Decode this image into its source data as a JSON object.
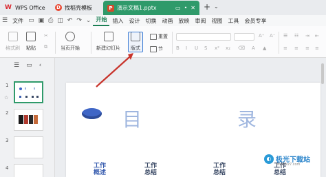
{
  "tabs": {
    "wps": {
      "logo": "W",
      "label": "WPS Office"
    },
    "template": {
      "logo": "D",
      "label": "找稻壳模板"
    },
    "doc": {
      "logo": "P",
      "label": "演示文稿1.pptx"
    },
    "add": "+",
    "more": "⌄"
  },
  "menu": {
    "hamburger": "☰",
    "file": "文件",
    "items": [
      "开始",
      "插入",
      "设计",
      "切换",
      "动画",
      "放映",
      "审阅",
      "视图",
      "工具",
      "会员专享"
    ],
    "active_index": 0
  },
  "ribbon": {
    "format_painter": "格式刷",
    "paste": "粘贴",
    "start_show": "当页开始",
    "new_slide": "新建幻灯片",
    "layout": "版式",
    "section": "节",
    "reset": "重置"
  },
  "sidebar": {
    "slides": [
      {
        "num": "1",
        "star": "☆"
      },
      {
        "num": "2"
      },
      {
        "num": "3"
      },
      {
        "num": "4"
      }
    ]
  },
  "slide": {
    "title_left": "目",
    "title_right": "录",
    "items": [
      "工作\n概述",
      "工作\n总结",
      "工作\n总结",
      "工作\n总结"
    ]
  },
  "watermark": {
    "brand": "极光下载站",
    "site": "www.xz7.com"
  },
  "colors": {
    "accent": "#2f9a6a",
    "arrow": "#c8332b",
    "highlight": "#3a7bd5"
  }
}
